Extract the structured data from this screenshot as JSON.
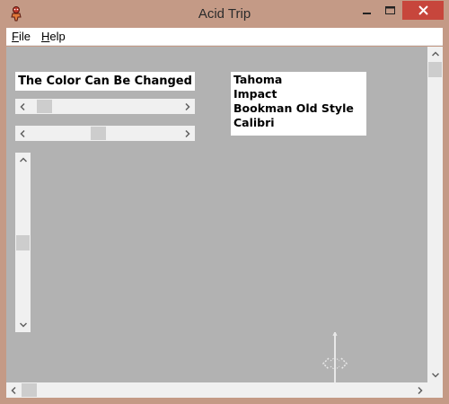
{
  "window": {
    "title": "Acid Trip"
  },
  "menu": {
    "items": [
      {
        "label_u": "F",
        "label_rest": "ile"
      },
      {
        "label_u": "H",
        "label_rest": "elp"
      }
    ]
  },
  "controls": {
    "color_label": "The Color Can Be Changed",
    "scrollbar_1_position": 0.05,
    "scrollbar_2_position": 0.45,
    "vertical_scrollbar_position": 0.5
  },
  "font_list": {
    "items": [
      "Tahoma",
      "Impact",
      "Bookman Old Style",
      "Calibri"
    ]
  },
  "colors": {
    "frame": "#c49a86",
    "client_background": "#b2b2b2",
    "close_button": "#c7463c"
  },
  "icons": {
    "app": "acid-trip-app-icon",
    "minimize": "minimize-icon",
    "maximize": "maximize-icon",
    "close": "close-icon"
  }
}
